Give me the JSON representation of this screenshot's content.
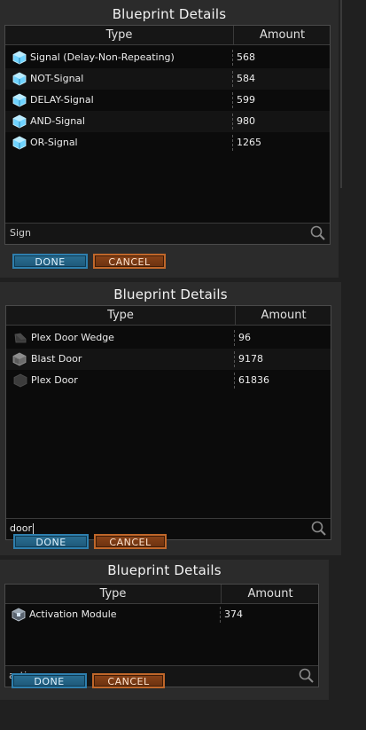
{
  "dialogs": [
    {
      "title": "Blueprint Details",
      "headers": {
        "type": "Type",
        "amount": "Amount"
      },
      "rows": [
        {
          "icon": "signal-cube-icon",
          "type": "Signal (Delay-Non-Repeating)",
          "amount": "568"
        },
        {
          "icon": "signal-cube-icon",
          "type": "NOT-Signal",
          "amount": "584"
        },
        {
          "icon": "signal-cube-icon",
          "type": "DELAY-Signal",
          "amount": "599"
        },
        {
          "icon": "signal-cube-icon",
          "type": "AND-Signal",
          "amount": "980"
        },
        {
          "icon": "signal-cube-icon",
          "type": "OR-Signal",
          "amount": "1265"
        }
      ],
      "search_value": "Sign",
      "done_label": "DONE",
      "cancel_label": "CANCEL"
    },
    {
      "title": "Blueprint Details",
      "headers": {
        "type": "Type",
        "amount": "Amount"
      },
      "rows": [
        {
          "icon": "wedge-block-icon",
          "type": "Plex Door Wedge",
          "amount": "96"
        },
        {
          "icon": "blast-door-block-icon",
          "type": "Blast Door",
          "amount": "9178"
        },
        {
          "icon": "hexagon-block-icon",
          "type": "Plex Door",
          "amount": "61836"
        }
      ],
      "search_value": "door",
      "done_label": "DONE",
      "cancel_label": "CANCEL"
    },
    {
      "title": "Blueprint Details",
      "headers": {
        "type": "Type",
        "amount": "Amount"
      },
      "rows": [
        {
          "icon": "activation-module-icon",
          "type": "Activation Module",
          "amount": "374"
        }
      ],
      "search_value": "activ",
      "done_label": "DONE",
      "cancel_label": "CANCEL"
    }
  ],
  "colors": {
    "done_accent": "#2e7fae",
    "cancel_accent": "#c0672a",
    "panel_bg": "#2b2b2b",
    "table_bg": "#0b0b0b"
  }
}
